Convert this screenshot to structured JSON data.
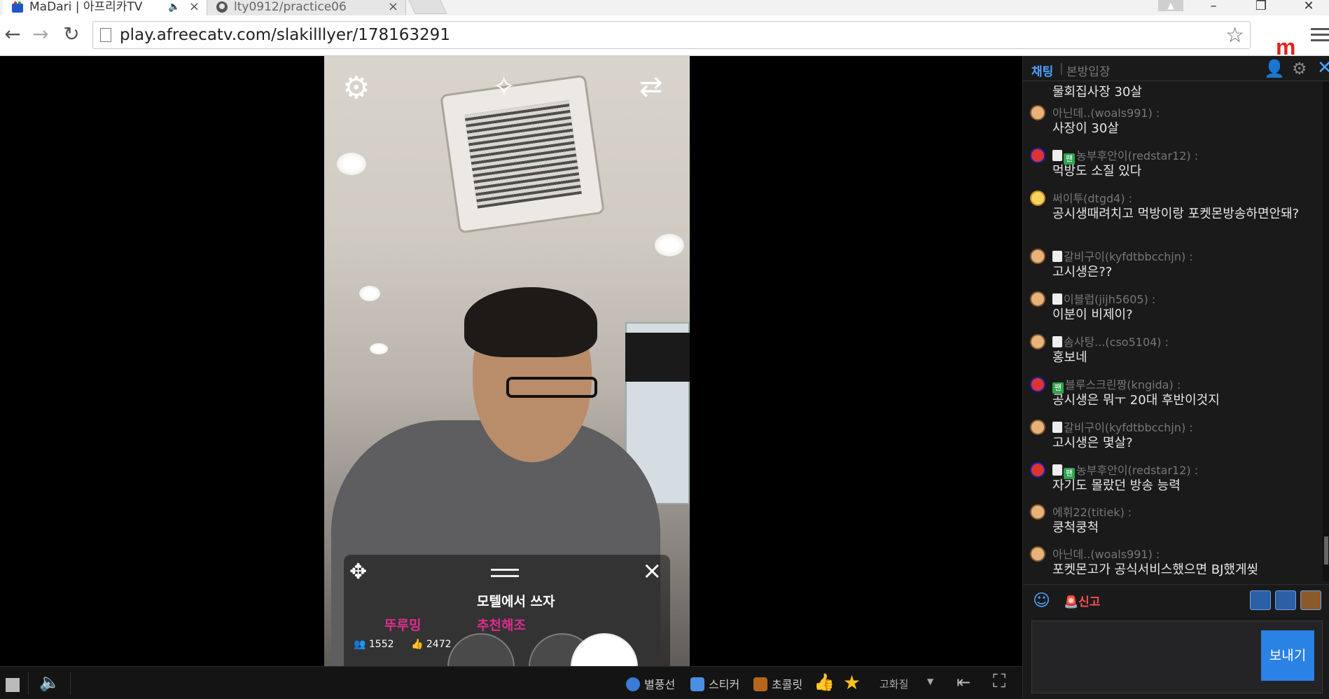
{
  "browser": {
    "tabs": [
      {
        "title": "MaDari | 아프리카TV",
        "active": true
      },
      {
        "title": "lty0912/practice06",
        "active": false
      }
    ],
    "url": "play.afreecatv.com/slakilllyer/178163291"
  },
  "player": {
    "overlay": {
      "message": "모텔에서 쓰자",
      "user": "뚜루밍",
      "recommend": "추천해조",
      "viewers": "1552",
      "likes": "2472"
    },
    "controls": {
      "balloon": "별풍선",
      "sticker": "스티커",
      "chocolate": "초콜릿",
      "quality": "고화질"
    }
  },
  "chat": {
    "tabs": {
      "active": "채팅",
      "other": "본방입장"
    },
    "messages": [
      {
        "nick": "",
        "text": "물회집사장 30살",
        "avatar": "face"
      },
      {
        "nick": "아닌데..(woals991) :",
        "text": "사장이 30살",
        "avatar": "face"
      },
      {
        "nick": "농부후안이(redstar12) :",
        "text": "먹방도 소질 있다",
        "avatar": "f",
        "badges": [
          "white",
          "팬"
        ]
      },
      {
        "nick": "써이투(dtgd4) :",
        "text": "공시생때려치고 먹방이랑 포켓몬방송하면안돼?",
        "avatar": "girl"
      },
      {
        "nick": "갈비구이(kyfdtbbcchjn) :",
        "text": "고시생은??",
        "avatar": "face",
        "badges": [
          "white"
        ]
      },
      {
        "nick": "이블럽(jijh5605) :",
        "text": "이분이 비제이?",
        "avatar": "face",
        "badges": [
          "white"
        ]
      },
      {
        "nick": "솜사탕...(cso5104) :",
        "text": "홍보네",
        "avatar": "face",
        "badges": [
          "white"
        ]
      },
      {
        "nick": "블루스크린짱(kngida) :",
        "text": "공시생은 뭐ㅜ 20대 후반이것지",
        "avatar": "f",
        "badges": [
          "팬"
        ]
      },
      {
        "nick": "갈비구이(kyfdtbbcchjn) :",
        "text": "고시생은 몇살?",
        "avatar": "face",
        "badges": [
          "white"
        ]
      },
      {
        "nick": "농부후안이(redstar12) :",
        "text": "자기도 몰랐던 방송 능력",
        "avatar": "f",
        "badges": [
          "white",
          "팬"
        ]
      },
      {
        "nick": "에휘22(titiek) :",
        "text": "쿵척쿵척",
        "avatar": "face"
      },
      {
        "nick": "아닌데..(woals991) :",
        "text": "포켓몬고가 공식서비스했으면 BJ했게씾",
        "avatar": "face"
      }
    ],
    "report": "신고",
    "send": "보내기"
  }
}
